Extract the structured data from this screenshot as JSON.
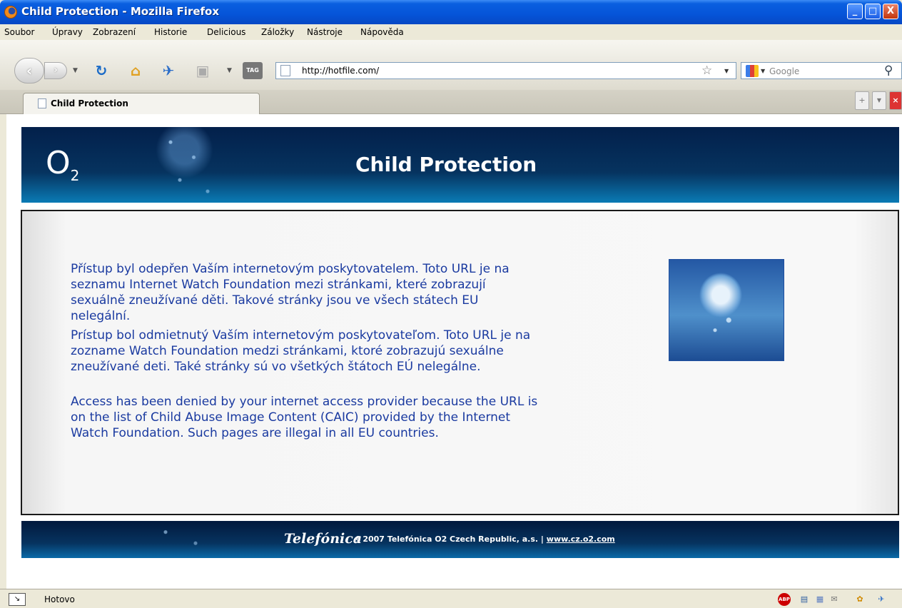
{
  "window": {
    "title": "Child Protection - Mozilla Firefox",
    "min_label": "_",
    "max_label": "□",
    "close_label": "X"
  },
  "menu": [
    "Soubor",
    "Úpravy",
    "Zobrazení",
    "Historie",
    "Delicious",
    "Záložky",
    "Nástroje",
    "Nápověda"
  ],
  "toolbar": {
    "url": "http://hotfile.com/",
    "search_placeholder": "Google",
    "tag_label": "TAG"
  },
  "tab": {
    "label": "Child Protection"
  },
  "page": {
    "logo": "O",
    "logo_sub": "2",
    "title": "Child Protection",
    "paragraphs": [
      "Přístup byl odepřen Vaším internetovým poskytovatelem. Toto URL je na seznamu Internet Watch Foundation mezi stránkami, které zobrazují sexuálně zneužívané děti. Takové stránky jsou ve všech státech EU nelegální.",
      "Prístup bol odmietnutý Vaším internetovým poskytovateľom. Toto URL je na zozname Watch Foundation medzi stránkami, ktoré zobrazujú sexuálne zneužívané deti. Také stránky sú vo všetkých štátoch EÚ nelegálne.",
      "Access has been denied by your internet access provider because the URL is on the list of Child Abuse Image Content (CAIC) provided by the Internet Watch Foundation. Such pages are illegal in all EU countries."
    ],
    "footer_brand": "Telefónica",
    "footer_copyright": "§ 2007 Telefónica O2 Czech Republic, a.s. |",
    "footer_link": "www.cz.o2.com"
  },
  "status": {
    "text": "Hotovo",
    "abp_label": "ABP"
  },
  "colors": {
    "body_text": "#1a3aa0",
    "banner_dark": "#03204b",
    "banner_light": "#0a7bb5"
  }
}
